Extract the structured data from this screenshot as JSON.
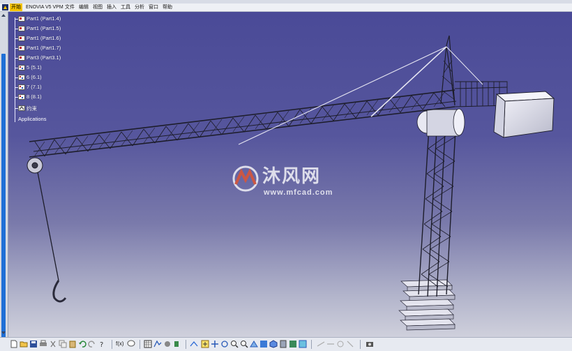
{
  "menu": {
    "items": [
      {
        "label": "开始",
        "active": true
      },
      {
        "label": "ENOVIA V5 VPM",
        "active": false
      },
      {
        "label": "文件",
        "active": false
      },
      {
        "label": "编辑",
        "active": false
      },
      {
        "label": "视图",
        "active": false
      },
      {
        "label": "插入",
        "active": false
      },
      {
        "label": "工具",
        "active": false
      },
      {
        "label": "分析",
        "active": false
      },
      {
        "label": "窗口",
        "active": false
      },
      {
        "label": "帮助",
        "active": false
      }
    ]
  },
  "tree": {
    "items": [
      {
        "label": "Part1 (Part1.4)",
        "icon": "part-icon"
      },
      {
        "label": "Part1 (Part1.5)",
        "icon": "part-icon"
      },
      {
        "label": "Part1 (Part1.6)",
        "icon": "part-icon"
      },
      {
        "label": "Part1 (Part1.7)",
        "icon": "part-icon"
      },
      {
        "label": "Part3 (Part3.1)",
        "icon": "part-icon"
      },
      {
        "label": "5 (5.1)",
        "icon": "product-icon"
      },
      {
        "label": "6 (6.1)",
        "icon": "product-icon"
      },
      {
        "label": "7 (7.1)",
        "icon": "product-icon"
      },
      {
        "label": "8 (8.1)",
        "icon": "product-icon"
      },
      {
        "label": "约束",
        "icon": "constraint-icon"
      }
    ],
    "applications": "Applications"
  },
  "watermark": {
    "brand": "沐风网",
    "url": "www.mfcad.com"
  },
  "toolbar": {
    "formula_label": "f(x)"
  },
  "colors": {
    "accent": "#f5c400",
    "viewport_top": "#4a4a97",
    "viewport_bottom": "#cfd0dc",
    "model": "#d9d9e6",
    "scroll_thumb": "#1f6fd6"
  }
}
